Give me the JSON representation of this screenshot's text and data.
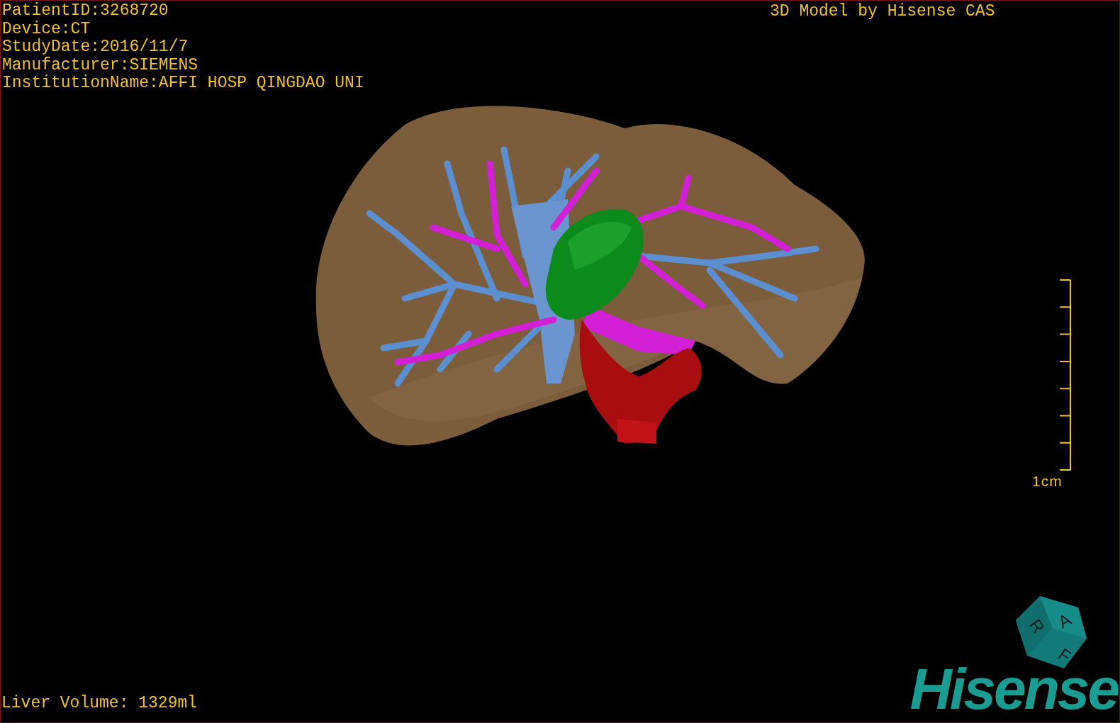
{
  "study_info": [
    "PatientID:3268720",
    "Device:CT",
    "StudyDate:2016/11/7",
    "Manufacturer:SIEMENS",
    "InstitutionName:AFFI HOSP QINGDAO UNI"
  ],
  "credit": "3D Model by Hisense CAS",
  "scale_bar": {
    "label": "1cm"
  },
  "orientation_cube": {
    "labels": [
      "R",
      "A",
      "F"
    ]
  },
  "liver_volume": "Liver Volume: 1329ml",
  "logo": "Hisense"
}
